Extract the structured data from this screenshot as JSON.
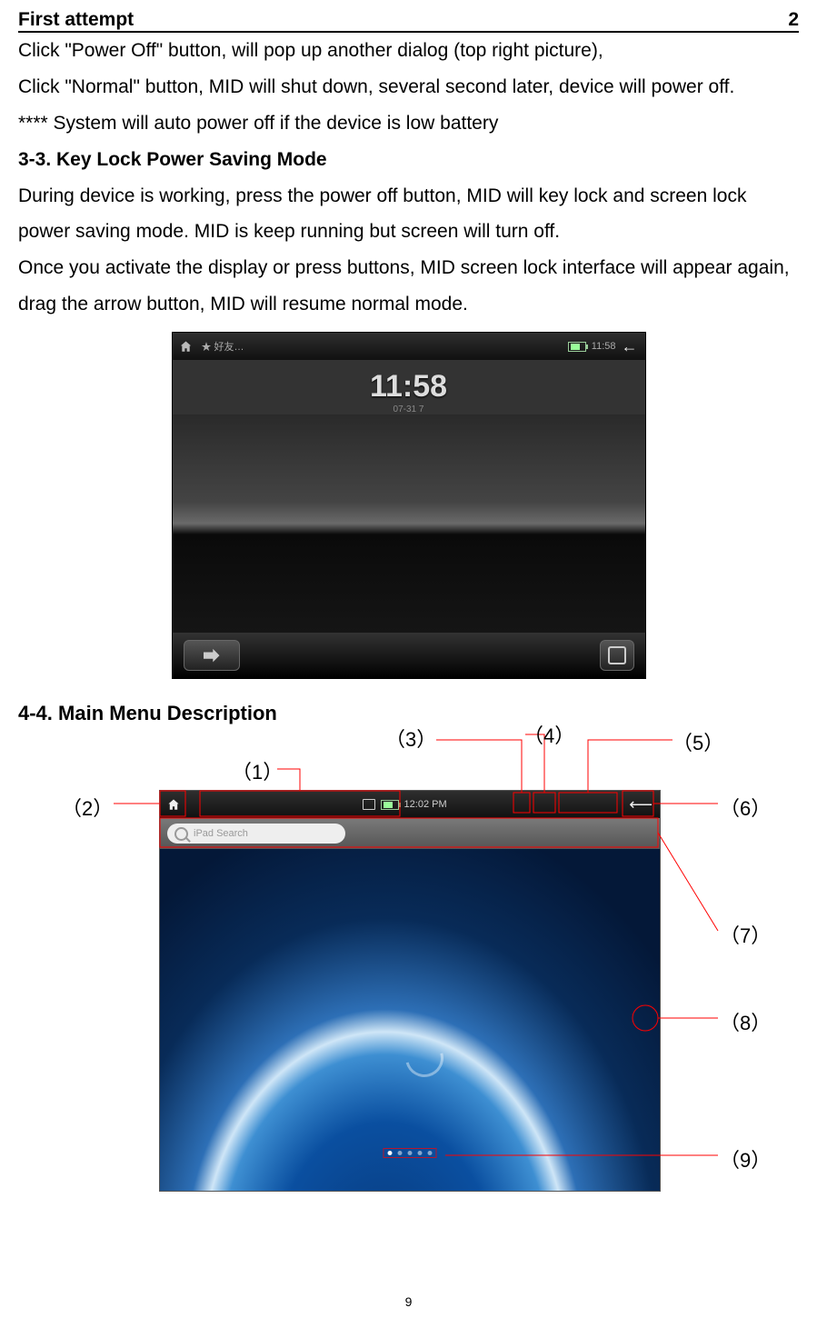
{
  "header": {
    "left": "First attempt",
    "right": "2"
  },
  "text": {
    "p1": "Click \"Power Off\" button, will pop up another dialog (top right picture),",
    "p2": "Click \"Normal\" button, MID will shut down, several second later, device will power off.",
    "p3": "**** System will auto power off if the device is low battery",
    "h33": "3-3.  Key Lock Power Saving Mode",
    "p4": "During device is working, press the power off button, MID will key lock and screen lock power saving mode. MID is keep running but screen will turn off.",
    "p5": "Once you activate the display or press buttons, MID screen lock interface will appear again, drag the arrow button, MID will resume normal mode.",
    "h44": "4-4. Main Menu Description"
  },
  "lockscreen": {
    "status_time": "11:58",
    "clock_time": "11:58",
    "clock_date": "07-31  7"
  },
  "mainmenu": {
    "status_time": "12:02 PM",
    "search_placeholder": "iPad Search"
  },
  "callouts": {
    "c1": "（1）",
    "c2": "（2）",
    "c3": "（3）",
    "c4": "（4）",
    "c5": "（5）",
    "c6": "（6）",
    "c7": "（7）",
    "c8": "（8）",
    "c9": "（9）"
  },
  "page_number": "9"
}
